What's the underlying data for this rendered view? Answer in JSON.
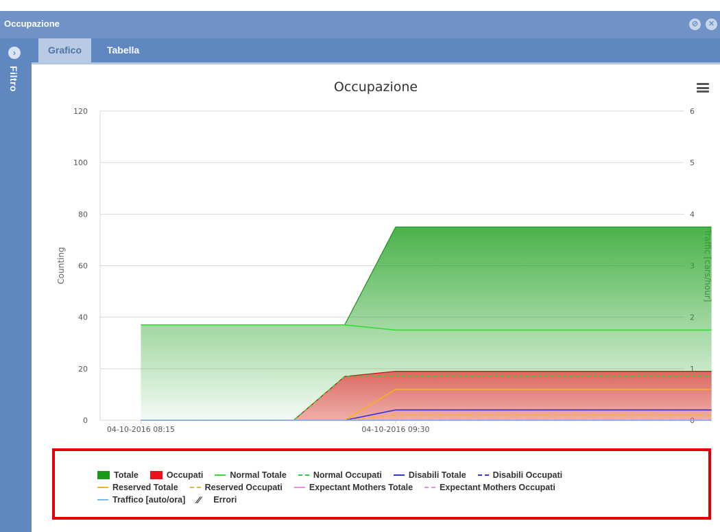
{
  "window": {
    "title": "Occupazione",
    "close_icon": "close-icon",
    "options_icon": "circle-x-icon"
  },
  "sidebar": {
    "toggle_icon": "chevron-right-icon",
    "label": "Filtro"
  },
  "tabs": [
    {
      "label": "Grafico",
      "active": true
    },
    {
      "label": "Tabella",
      "active": false
    }
  ],
  "menu_icon": "hamburger-menu-icon",
  "chart_data": {
    "type": "area",
    "title": "Occupazione",
    "ylabel_left": "Counting",
    "ylabel_right": "Traffic [cars/hour]",
    "y_left_range": [
      0,
      120
    ],
    "y_right_range": [
      0,
      6
    ],
    "y_left_ticks": [
      "0",
      "20",
      "40",
      "60",
      "80",
      "100",
      "120"
    ],
    "y_right_ticks": [
      "0",
      "1",
      "2",
      "3",
      "4",
      "5",
      "6"
    ],
    "x_tick_labels": [
      "04-10-2016 08:15",
      "04-10-2016 09:30"
    ],
    "x_tick_minutes": [
      0,
      75
    ],
    "x_range_minutes": [
      -12,
      160
    ],
    "grid": true,
    "series": [
      {
        "name": "Totale",
        "kind": "area",
        "color": "#1a9a1a",
        "x": [
          0,
          60,
          75,
          168
        ],
        "values": [
          37,
          37,
          75,
          75
        ]
      },
      {
        "name": "Occupati",
        "kind": "area",
        "color": "#e8131a",
        "x": [
          0,
          45,
          60,
          75,
          168
        ],
        "values": [
          0,
          0,
          17,
          19,
          19
        ]
      },
      {
        "name": "Normal Totale",
        "kind": "line",
        "color": "#33dd33",
        "x": [
          0,
          60,
          75,
          168
        ],
        "values": [
          37,
          37,
          35,
          35
        ]
      },
      {
        "name": "Normal Occupati",
        "kind": "dash",
        "color": "#33cc33",
        "x": [
          0,
          45,
          60,
          168
        ],
        "values": [
          0,
          0,
          17,
          17
        ]
      },
      {
        "name": "Disabili Totale",
        "kind": "line",
        "color": "#3333dd",
        "x": [
          0,
          60,
          75,
          168
        ],
        "values": [
          0,
          0,
          4,
          4
        ]
      },
      {
        "name": "Disabili Occupati",
        "kind": "dashdot",
        "color": "#3333dd",
        "x": [
          0,
          168
        ],
        "values": [
          0,
          0
        ]
      },
      {
        "name": "Reserved Totale",
        "kind": "line",
        "color": "#f5b21a",
        "x": [
          0,
          60,
          75,
          168
        ],
        "values": [
          0,
          0,
          12,
          12
        ]
      },
      {
        "name": "Reserved Occupati",
        "kind": "dashdot",
        "color": "#f5b21a",
        "x": [
          0,
          60,
          75,
          168
        ],
        "values": [
          0,
          0,
          2,
          2
        ]
      },
      {
        "name": "Expectant Mothers Totale",
        "kind": "line",
        "color": "#ee88ee",
        "x": [
          0,
          168
        ],
        "values": [
          0,
          0
        ]
      },
      {
        "name": "Expectant Mothers Occupati",
        "kind": "dashdot",
        "color": "#ee88ee",
        "x": [
          0,
          168
        ],
        "values": [
          0,
          0
        ]
      },
      {
        "name": "Traffico [auto/ora]",
        "kind": "line",
        "color": "#7ab8e8",
        "x": [
          0,
          168
        ],
        "values": [
          0,
          0
        ]
      },
      {
        "name": "Errori",
        "kind": "hatch",
        "color": "#333333",
        "x": [],
        "values": []
      }
    ]
  },
  "legend_rows": [
    [
      0,
      1,
      2,
      3,
      4,
      5
    ],
    [
      6,
      7,
      8,
      9
    ],
    [
      10,
      11
    ]
  ]
}
